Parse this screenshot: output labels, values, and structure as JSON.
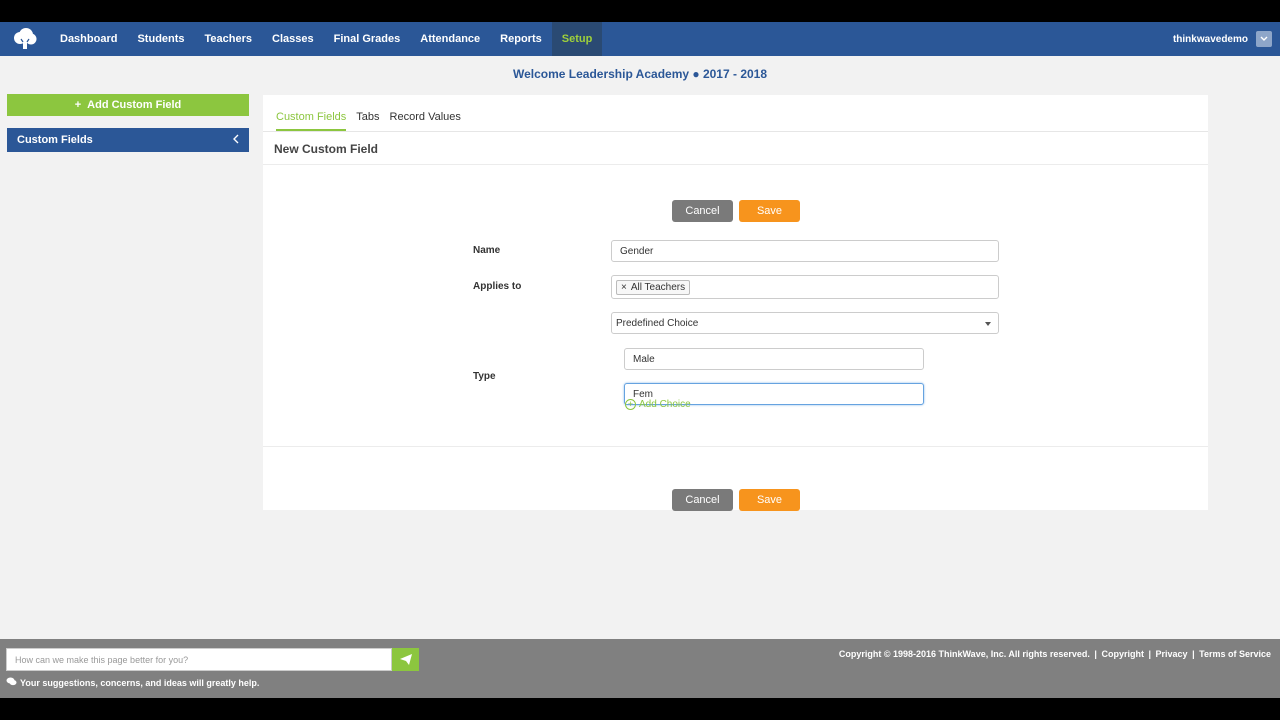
{
  "nav": {
    "items": [
      "Dashboard",
      "Students",
      "Teachers",
      "Classes",
      "Final Grades",
      "Attendance",
      "Reports",
      "Setup"
    ],
    "active": "Setup",
    "username": "thinkwavedemo"
  },
  "school": {
    "title": "Welcome Leadership Academy  ● 2017 - 2018"
  },
  "sidebar": {
    "add_button": "Add Custom Field",
    "section_label": "Custom Fields"
  },
  "tabs": [
    "Custom Fields",
    "Tabs",
    "Record Values"
  ],
  "form": {
    "heading": "New Custom Field",
    "cancel_label": "Cancel",
    "save_label": "Save",
    "name_label": "Name",
    "name_value": "Gender",
    "applies_label": "Applies to",
    "applies_tag": "All Teachers",
    "type_select": "Predefined Choice",
    "type_label": "Type",
    "choices": [
      "Male",
      "Fem"
    ],
    "add_choice_label": "Add Choice"
  },
  "footer": {
    "feedback_placeholder": "How can we make this page better for you?",
    "feedback_note": "Your suggestions, concerns, and ideas will greatly help.",
    "copyright": "Copyright © 1998-2016 ThinkWave, Inc. All rights reserved.",
    "links": [
      "Copyright",
      "Privacy",
      "Terms of Service"
    ]
  },
  "colors": {
    "nav": "#2b5797",
    "accent_green": "#8cc63f",
    "save_orange": "#f7941d"
  }
}
